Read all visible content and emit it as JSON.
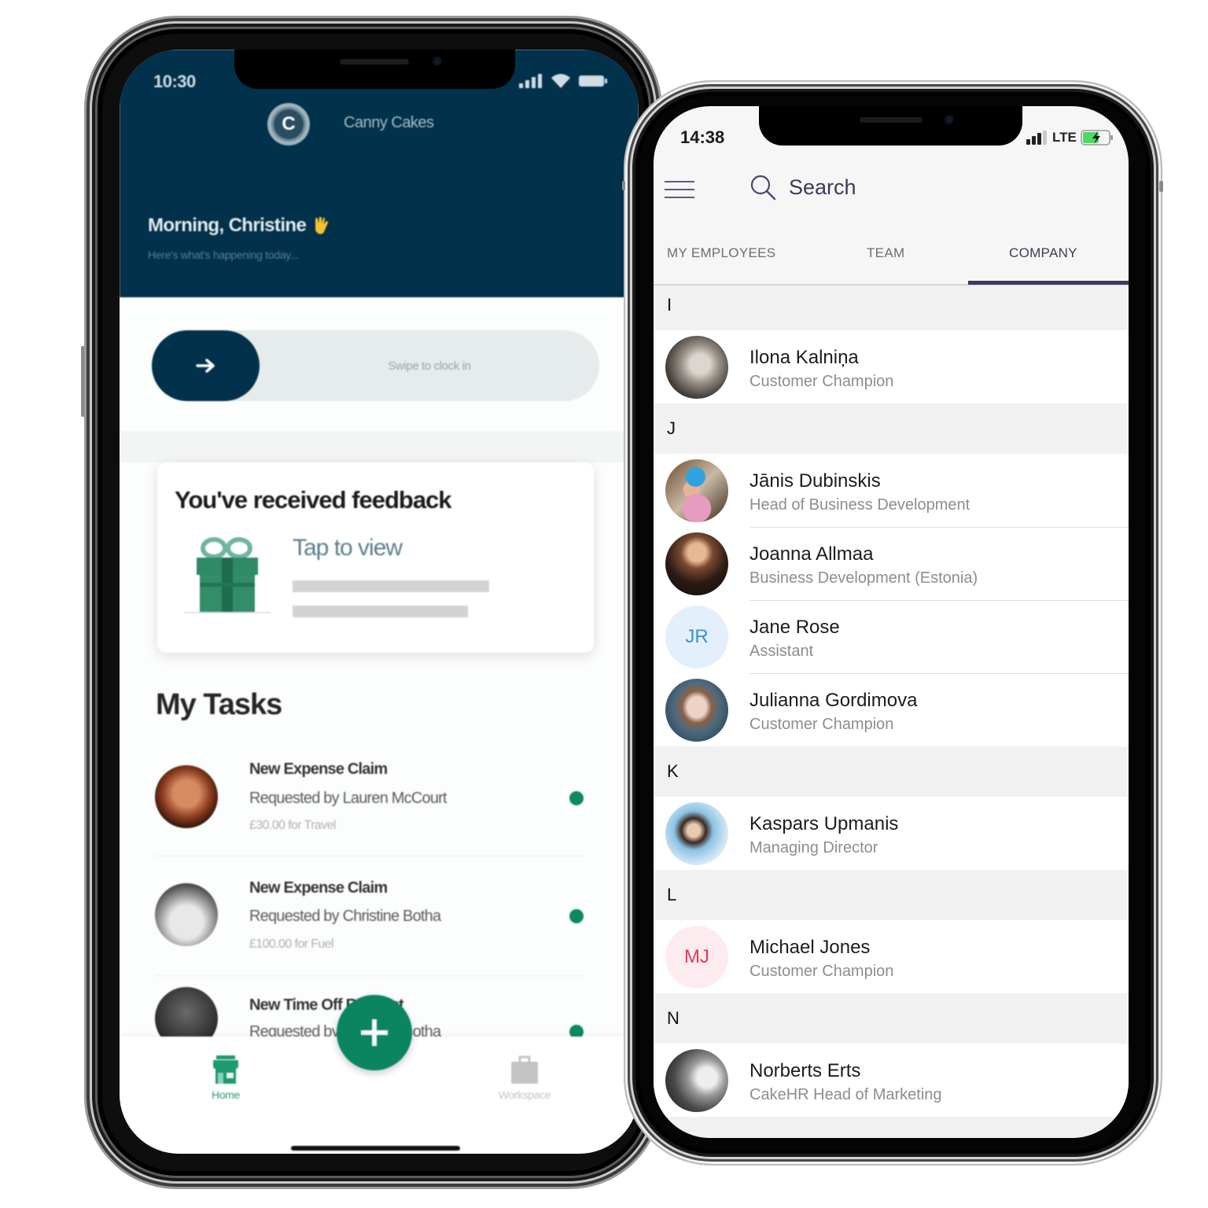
{
  "colors": {
    "brand_navy": "#01314b",
    "accent_green": "#0a8560",
    "tab_active": "#3c3a5c",
    "initials_jr": "#3d8fd6",
    "initials_jr_bg": "#e3f0fb",
    "initials_mj": "#e8375a",
    "initials_mj_bg": "#fdecef",
    "battery_green": "#4cd964"
  },
  "left_phone": {
    "status_bar": {
      "time": "10:30"
    },
    "header": {
      "logo_letter": "C",
      "brand": "Canny Cakes",
      "greeting": "Morning, Christine",
      "greeting_icon": "waving-hand",
      "subtitle": "Here's what's happening today..."
    },
    "clock_in": {
      "label": "Swipe to clock in",
      "icon": "arrow-right"
    },
    "feedback_card": {
      "title": "You've received feedback",
      "link": "Tap to view",
      "icon": "gift"
    },
    "tasks": {
      "title": "My Tasks",
      "items": [
        {
          "title": "New Expense Claim",
          "requester": "Requested by Lauren McCourt",
          "detail": "£30.00 for Travel",
          "unread": true
        },
        {
          "title": "New Expense Claim",
          "requester": "Requested by Christine Botha",
          "detail": "£100.00 for Fuel",
          "unread": true
        },
        {
          "title": "New Time Off Request",
          "requester": "Requested by Christine Botha",
          "unread": true
        }
      ]
    },
    "bottom_nav": {
      "items": [
        {
          "label": "Home",
          "icon": "store",
          "active": true
        },
        {
          "label": "Workspace",
          "icon": "briefcase",
          "active": false
        }
      ],
      "fab_icon": "plus"
    }
  },
  "right_phone": {
    "status_bar": {
      "time": "14:38",
      "network": "LTE",
      "battery": "charging"
    },
    "toolbar": {
      "menu_icon": "hamburger",
      "search_placeholder": "Search"
    },
    "tabs": [
      {
        "label": "MY EMPLOYEES",
        "active": false
      },
      {
        "label": "TEAM",
        "active": false
      },
      {
        "label": "COMPANY",
        "active": true
      }
    ],
    "directory": {
      "sections": [
        {
          "letter": "I",
          "people": [
            {
              "name": "Ilona Kalniņa",
              "role": "Customer Champion",
              "avatar": "photo"
            }
          ]
        },
        {
          "letter": "J",
          "people": [
            {
              "name": "Jānis Dubinskis",
              "role": "Head of Business Development",
              "avatar": "photo"
            },
            {
              "name": "Joanna Allmaa",
              "role": "Business Development (Estonia)",
              "avatar": "photo"
            },
            {
              "name": "Jane Rose",
              "role": "Assistant",
              "avatar": "initials",
              "initials": "JR"
            },
            {
              "name": "Julianna Gordimova",
              "role": "Customer Champion",
              "avatar": "photo"
            }
          ]
        },
        {
          "letter": "K",
          "people": [
            {
              "name": "Kaspars Upmanis",
              "role": "Managing Director",
              "avatar": "photo"
            }
          ]
        },
        {
          "letter": "L",
          "people": [
            {
              "name": "Michael Jones",
              "role": "Customer Champion",
              "avatar": "initials",
              "initials": "MJ"
            }
          ]
        },
        {
          "letter": "N",
          "people": [
            {
              "name": "Norberts Erts",
              "role": "CakeHR Head of Marketing",
              "avatar": "photo"
            }
          ]
        }
      ]
    }
  }
}
